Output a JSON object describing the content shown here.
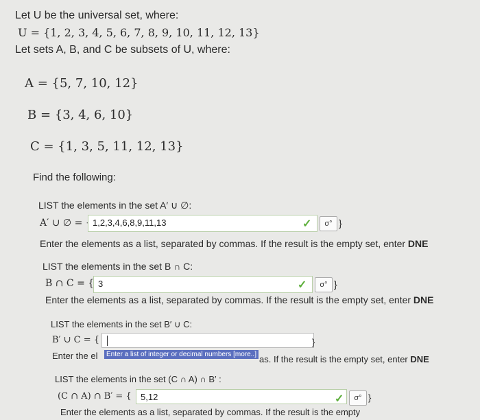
{
  "intro": {
    "line1": "Let U be the universal set, where:",
    "universal": "U = {1, 2, 3, 4, 5, 6, 7, 8, 9, 10, 11, 12, 13}",
    "line3": "Let sets A, B, and C be subsets of U, where:"
  },
  "sets": {
    "A": "A = {5, 7, 10, 12}",
    "B": "B = {3, 4, 6, 10}",
    "C": "C = {1, 3, 5, 11, 12, 13}"
  },
  "find": "Find the following:",
  "questions": [
    {
      "prompt": "LIST the elements in the set A′ ∪ ∅:",
      "lhs": "A′ ∪ ∅ = {",
      "value": "1,2,3,4,6,8,9,11,13",
      "close": "}",
      "instr": "Enter the elements as a list, separated by commas. If the result is the empty set, enter ",
      "instr_bold": "DNE"
    },
    {
      "prompt": "LIST the elements in the set B ∩ C:",
      "lhs": "B ∩ C = {",
      "value": "3",
      "close": "}",
      "instr": "Enter the elements as a list, separated by commas. If the result is the empty set, enter ",
      "instr_bold": "DNE"
    },
    {
      "prompt": "LIST the elements in the set B′ ∪ C:",
      "lhs": "B′ ∪ C = {",
      "value": "",
      "close": "}",
      "instr_left": "Enter the el",
      "instr_right": "as. If the result is the empty set, enter ",
      "instr_bold": "DNE",
      "tooltip": "Enter a list of integer or decimal numbers [more..]"
    },
    {
      "prompt": "LIST the elements in the set (C ∩ A) ∩ B′ :",
      "lhs": "(C ∩ A) ∩ B′ = {",
      "value": "5,12",
      "close": "}",
      "instr": "Enter the elements as a list, separated by commas. If the result is the empty"
    }
  ],
  "editor_icon": "σ°",
  "check_icon": "✓"
}
